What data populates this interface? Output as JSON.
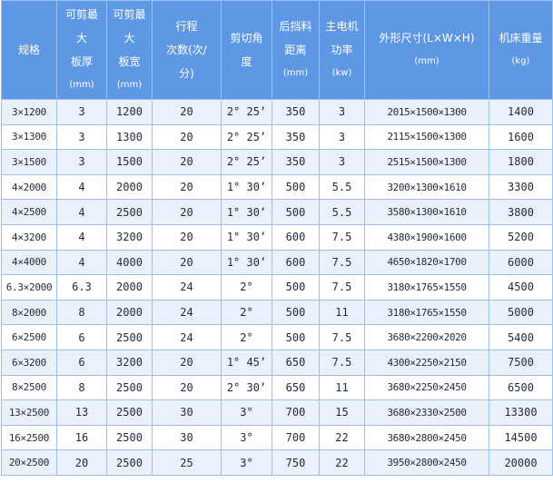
{
  "columns": [
    {
      "key": "spec",
      "lines": [
        "规格"
      ],
      "unit": ""
    },
    {
      "key": "thickness",
      "lines": [
        "可剪最",
        "大",
        "板厚"
      ],
      "unit": "(mm)"
    },
    {
      "key": "width",
      "lines": [
        "可剪最",
        "大",
        "板宽"
      ],
      "unit": "(mm)"
    },
    {
      "key": "strokes",
      "lines": [
        "行程",
        "次数(次/",
        "分)"
      ],
      "unit": ""
    },
    {
      "key": "angle",
      "lines": [
        "剪切角",
        "度"
      ],
      "unit": ""
    },
    {
      "key": "backgauge",
      "lines": [
        "后挡料",
        "距离"
      ],
      "unit": "(mm)"
    },
    {
      "key": "power",
      "lines": [
        "主电机",
        "功率"
      ],
      "unit": "(kw)"
    },
    {
      "key": "dims",
      "lines": [
        "外形尺寸(L×W×H)"
      ],
      "unit": "(mm)"
    },
    {
      "key": "weight",
      "lines": [
        "机床重量"
      ],
      "unit": "(kg)"
    }
  ],
  "rows": [
    {
      "spec": "3×1200",
      "thickness": "3",
      "width": "1200",
      "strokes": "20",
      "angle": "2° 25’",
      "backgauge": "350",
      "power": "3",
      "dims": "2015×1500×1300",
      "weight": "1400"
    },
    {
      "spec": "3×1300",
      "thickness": "3",
      "width": "1300",
      "strokes": "20",
      "angle": "2° 25’",
      "backgauge": "350",
      "power": "3",
      "dims": "2115×1500×1300",
      "weight": "1600"
    },
    {
      "spec": "3×1500",
      "thickness": "3",
      "width": "1500",
      "strokes": "20",
      "angle": "2° 25’",
      "backgauge": "350",
      "power": "3",
      "dims": "2515×1500×1300",
      "weight": "1800"
    },
    {
      "spec": "4×2000",
      "thickness": "4",
      "width": "2000",
      "strokes": "20",
      "angle": "1° 30’",
      "backgauge": "500",
      "power": "5.5",
      "dims": "3200×1300×1610",
      "weight": "3300"
    },
    {
      "spec": "4×2500",
      "thickness": "4",
      "width": "2500",
      "strokes": "20",
      "angle": "1° 30’",
      "backgauge": "500",
      "power": "5.5",
      "dims": "3580×1300×1610",
      "weight": "3800"
    },
    {
      "spec": "4×3200",
      "thickness": "4",
      "width": "3200",
      "strokes": "20",
      "angle": "1° 30’",
      "backgauge": "600",
      "power": "7.5",
      "dims": "4380×1900×1600",
      "weight": "5200"
    },
    {
      "spec": "4×4000",
      "thickness": "4",
      "width": "4000",
      "strokes": "20",
      "angle": "1° 30’",
      "backgauge": "600",
      "power": "7.5",
      "dims": "4650×1820×1700",
      "weight": "6000"
    },
    {
      "spec": "6.3×2000",
      "thickness": "6.3",
      "width": "2000",
      "strokes": "24",
      "angle": "2°",
      "backgauge": "500",
      "power": "7.5",
      "dims": "3180×1765×1550",
      "weight": "4500"
    },
    {
      "spec": "8×2000",
      "thickness": "8",
      "width": "2000",
      "strokes": "24",
      "angle": "2°",
      "backgauge": "500",
      "power": "11",
      "dims": "3180×1765×1550",
      "weight": "5000"
    },
    {
      "spec": "6×2500",
      "thickness": "6",
      "width": "2500",
      "strokes": "24",
      "angle": "2°",
      "backgauge": "500",
      "power": "7.5",
      "dims": "3680×2200×2020",
      "weight": "5400"
    },
    {
      "spec": "6×3200",
      "thickness": "6",
      "width": "3200",
      "strokes": "20",
      "angle": "1° 45’",
      "backgauge": "650",
      "power": "7.5",
      "dims": "4300×2250×2150",
      "weight": "7500"
    },
    {
      "spec": "8×2500",
      "thickness": "8",
      "width": "2500",
      "strokes": "20",
      "angle": "2° 30’",
      "backgauge": "650",
      "power": "11",
      "dims": "3680×2250×2450",
      "weight": "6500"
    },
    {
      "spec": "13×2500",
      "thickness": "13",
      "width": "2500",
      "strokes": "30",
      "angle": "3°",
      "backgauge": "700",
      "power": "15",
      "dims": "3680×2330×2500",
      "weight": "13300"
    },
    {
      "spec": "16×2500",
      "thickness": "16",
      "width": "2500",
      "strokes": "30",
      "angle": "3°",
      "backgauge": "700",
      "power": "22",
      "dims": "3680×2800×2450",
      "weight": "14500"
    },
    {
      "spec": "20×2500",
      "thickness": "20",
      "width": "2500",
      "strokes": "25",
      "angle": "3°",
      "backgauge": "750",
      "power": "22",
      "dims": "3950×2800×2450",
      "weight": "20000"
    }
  ]
}
